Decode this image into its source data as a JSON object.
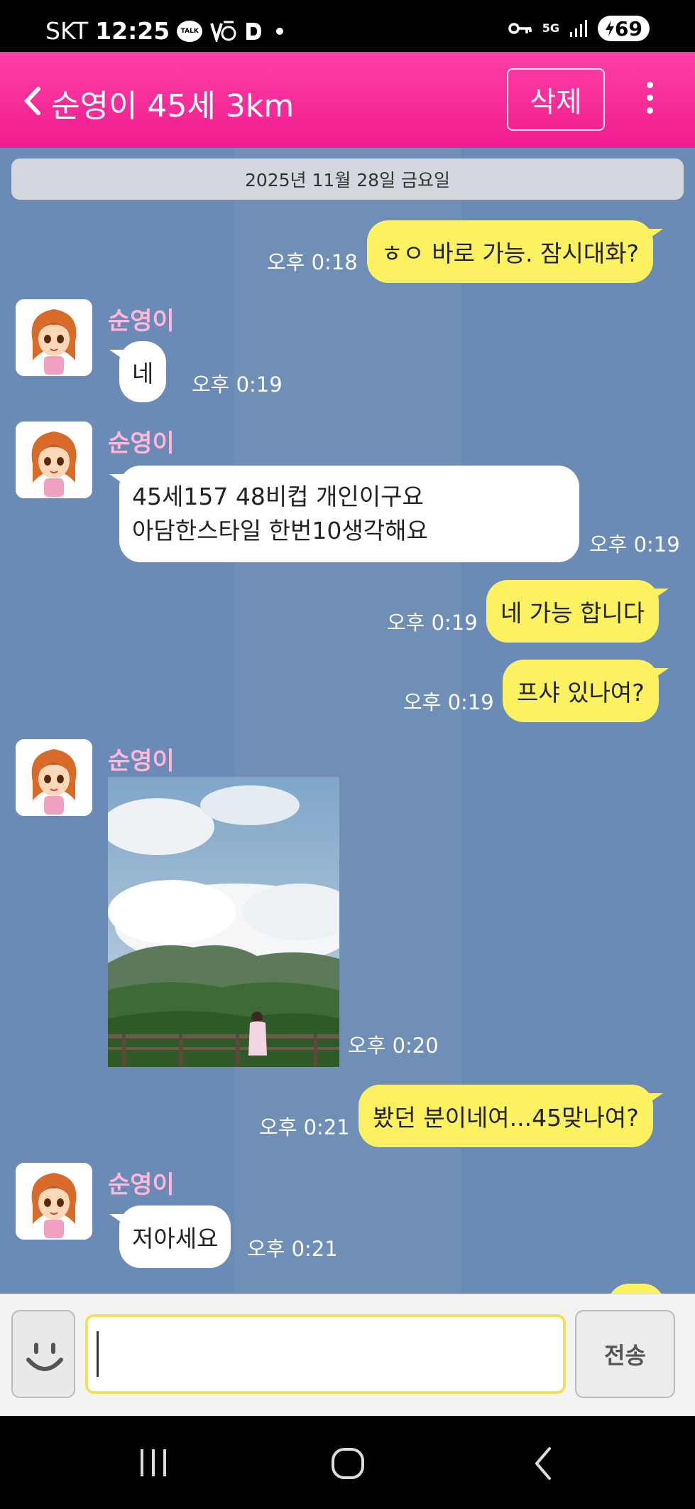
{
  "status_bar": {
    "carrier": "SKT",
    "time": "12:25",
    "talk_badge": "TALK",
    "network": "5G",
    "battery": "69"
  },
  "header": {
    "title": "순영이 45세 3km",
    "delete_label": "삭제"
  },
  "chat": {
    "date_divider": "2025년 11월 28일 금요일",
    "partner_name": "순영이",
    "messages": [
      {
        "text": "ㅎㅇ 바로 가능. 잠시대화?",
        "time": "오후 0:18"
      },
      {
        "text": "네",
        "time": "오후 0:19"
      },
      {
        "line1": "45세157 48비컵 개인이구요",
        "line2": "아담한스타일 한번10생각해요",
        "time": "오후 0:19"
      },
      {
        "text": "네 가능 합니다",
        "time": "오후 0:19"
      },
      {
        "text": "프샤 있나여?",
        "time": "오후 0:19"
      },
      {
        "time": "오후 0:20"
      },
      {
        "text": "봤던 분이네여...45맞나여?",
        "time": "오후 0:21"
      },
      {
        "text": "저아세요",
        "time": "오후 0:21"
      }
    ]
  },
  "input": {
    "value": "",
    "send_label": "전송"
  },
  "colors": {
    "header": "#f01c8f",
    "chat_bg": "#6a8bb5",
    "my_bubble": "#fcf261",
    "their_bubble": "#ffffff",
    "partner_name": "#ffb6d9"
  }
}
